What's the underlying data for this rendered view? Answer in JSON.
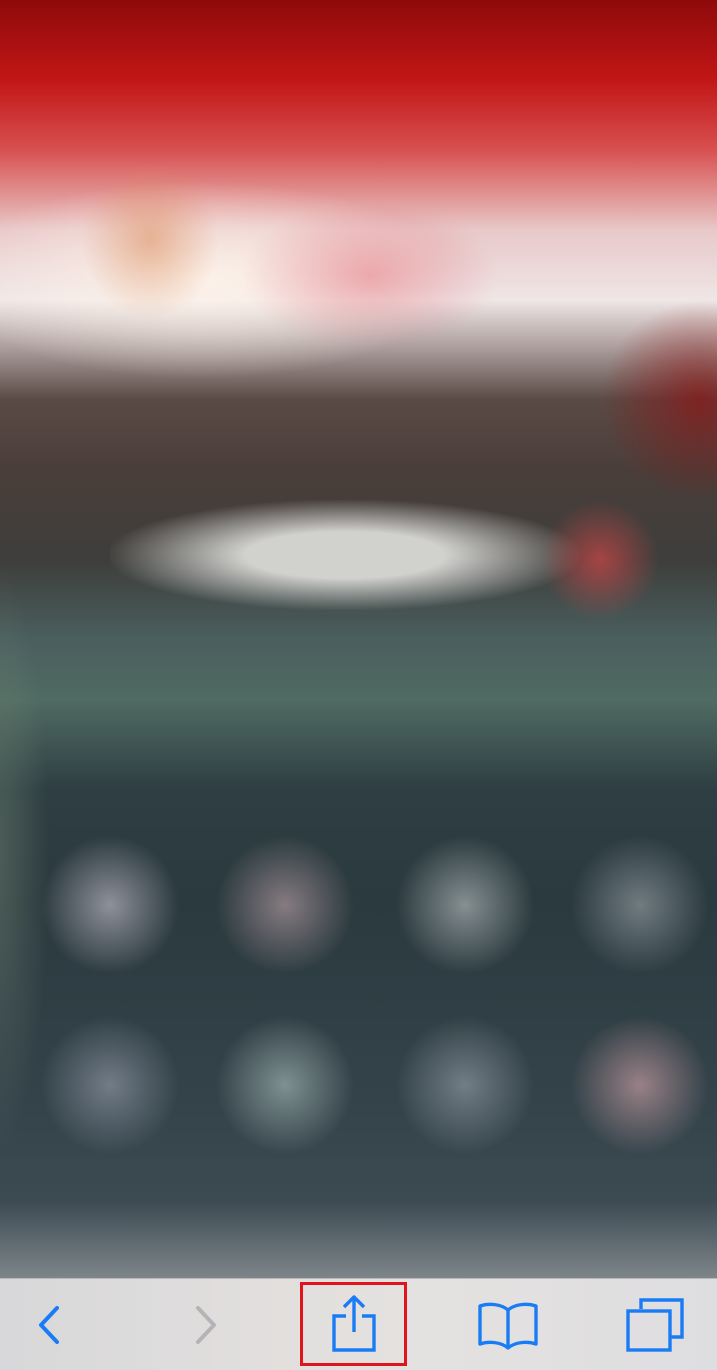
{
  "browser": {
    "page_content": "blurred",
    "toolbar": {
      "buttons": [
        {
          "id": "back",
          "icon": "chevron-left-icon",
          "enabled": true
        },
        {
          "id": "forward",
          "icon": "chevron-right-icon",
          "enabled": false
        },
        {
          "id": "share",
          "icon": "share-icon",
          "enabled": true,
          "highlighted": true
        },
        {
          "id": "bookmarks",
          "icon": "book-icon",
          "enabled": true
        },
        {
          "id": "tabs",
          "icon": "tabs-icon",
          "enabled": true
        }
      ],
      "colors": {
        "icon_active": "#1a7cf5",
        "icon_disabled": "#b4b4b8",
        "highlight": "#e0141c",
        "background": "#e0dfde"
      }
    }
  }
}
